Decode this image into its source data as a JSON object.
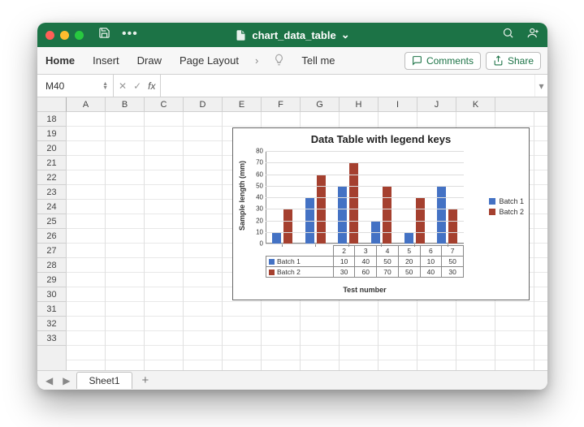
{
  "window": {
    "filename": "chart_data_table",
    "title_chevron": "⌄"
  },
  "ribbon": {
    "tabs": [
      "Home",
      "Insert",
      "Draw",
      "Page Layout"
    ],
    "tellme": "Tell me",
    "comments": "Comments",
    "share": "Share"
  },
  "formula_bar": {
    "cell_ref": "M40",
    "formula": ""
  },
  "columns": [
    "A",
    "B",
    "C",
    "D",
    "E",
    "F",
    "G",
    "H",
    "I",
    "J",
    "K"
  ],
  "rows_start": 18,
  "rows_end": 33,
  "sheet_tabs": {
    "active": "Sheet1"
  },
  "chart_data": {
    "type": "bar",
    "title": "Data Table with legend keys",
    "xlabel": "Test number",
    "ylabel": "Sample length (mm)",
    "categories": [
      "2",
      "3",
      "4",
      "5",
      "6",
      "7"
    ],
    "series": [
      {
        "name": "Batch 1",
        "color": "#4472c4",
        "values": [
          10,
          40,
          50,
          20,
          10,
          50
        ]
      },
      {
        "name": "Batch 2",
        "color": "#a5402f",
        "values": [
          30,
          60,
          70,
          50,
          40,
          30
        ]
      }
    ],
    "ylim": [
      0,
      80
    ],
    "y_ticks": [
      0,
      10,
      20,
      30,
      40,
      50,
      60,
      70,
      80
    ],
    "grid": true,
    "legend_position": "right",
    "data_table_below": true
  }
}
